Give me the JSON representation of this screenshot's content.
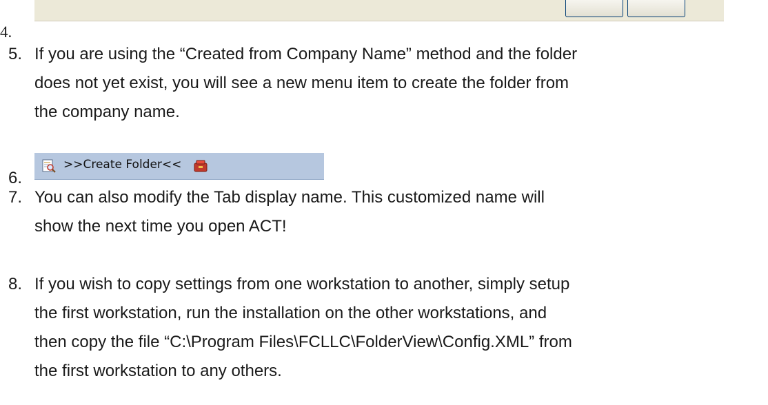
{
  "items": [
    {
      "number": "4."
    },
    {
      "number": "5.",
      "lines": [
        "If you are using the “Created from Company Name” method and the folder",
        "does not yet exist, you will see a new menu item to create the folder from",
        "the company name."
      ]
    },
    {
      "number": "6."
    },
    {
      "number": "7.",
      "lines": [
        "You can also modify the Tab display name.  This customized name will",
        "show the next time you open ACT!"
      ]
    },
    {
      "number": "8.",
      "lines": [
        "If you wish to copy settings from one workstation to another, simply setup",
        "the first workstation, run the installation on the other workstations,  and",
        "then copy the file “C:\\Program Files\\FCLLC\\FolderView\\Config.XML” from",
        "the first workstation to any others."
      ]
    }
  ],
  "toolbar": {
    "create_folder_label": ">>Create Folder<<",
    "icons": [
      "document-magnifier-icon",
      "folder-tool-icon"
    ]
  },
  "colors": {
    "toolbar_bg": "#b6c7df",
    "dialog_bg": "#ece9d8"
  }
}
